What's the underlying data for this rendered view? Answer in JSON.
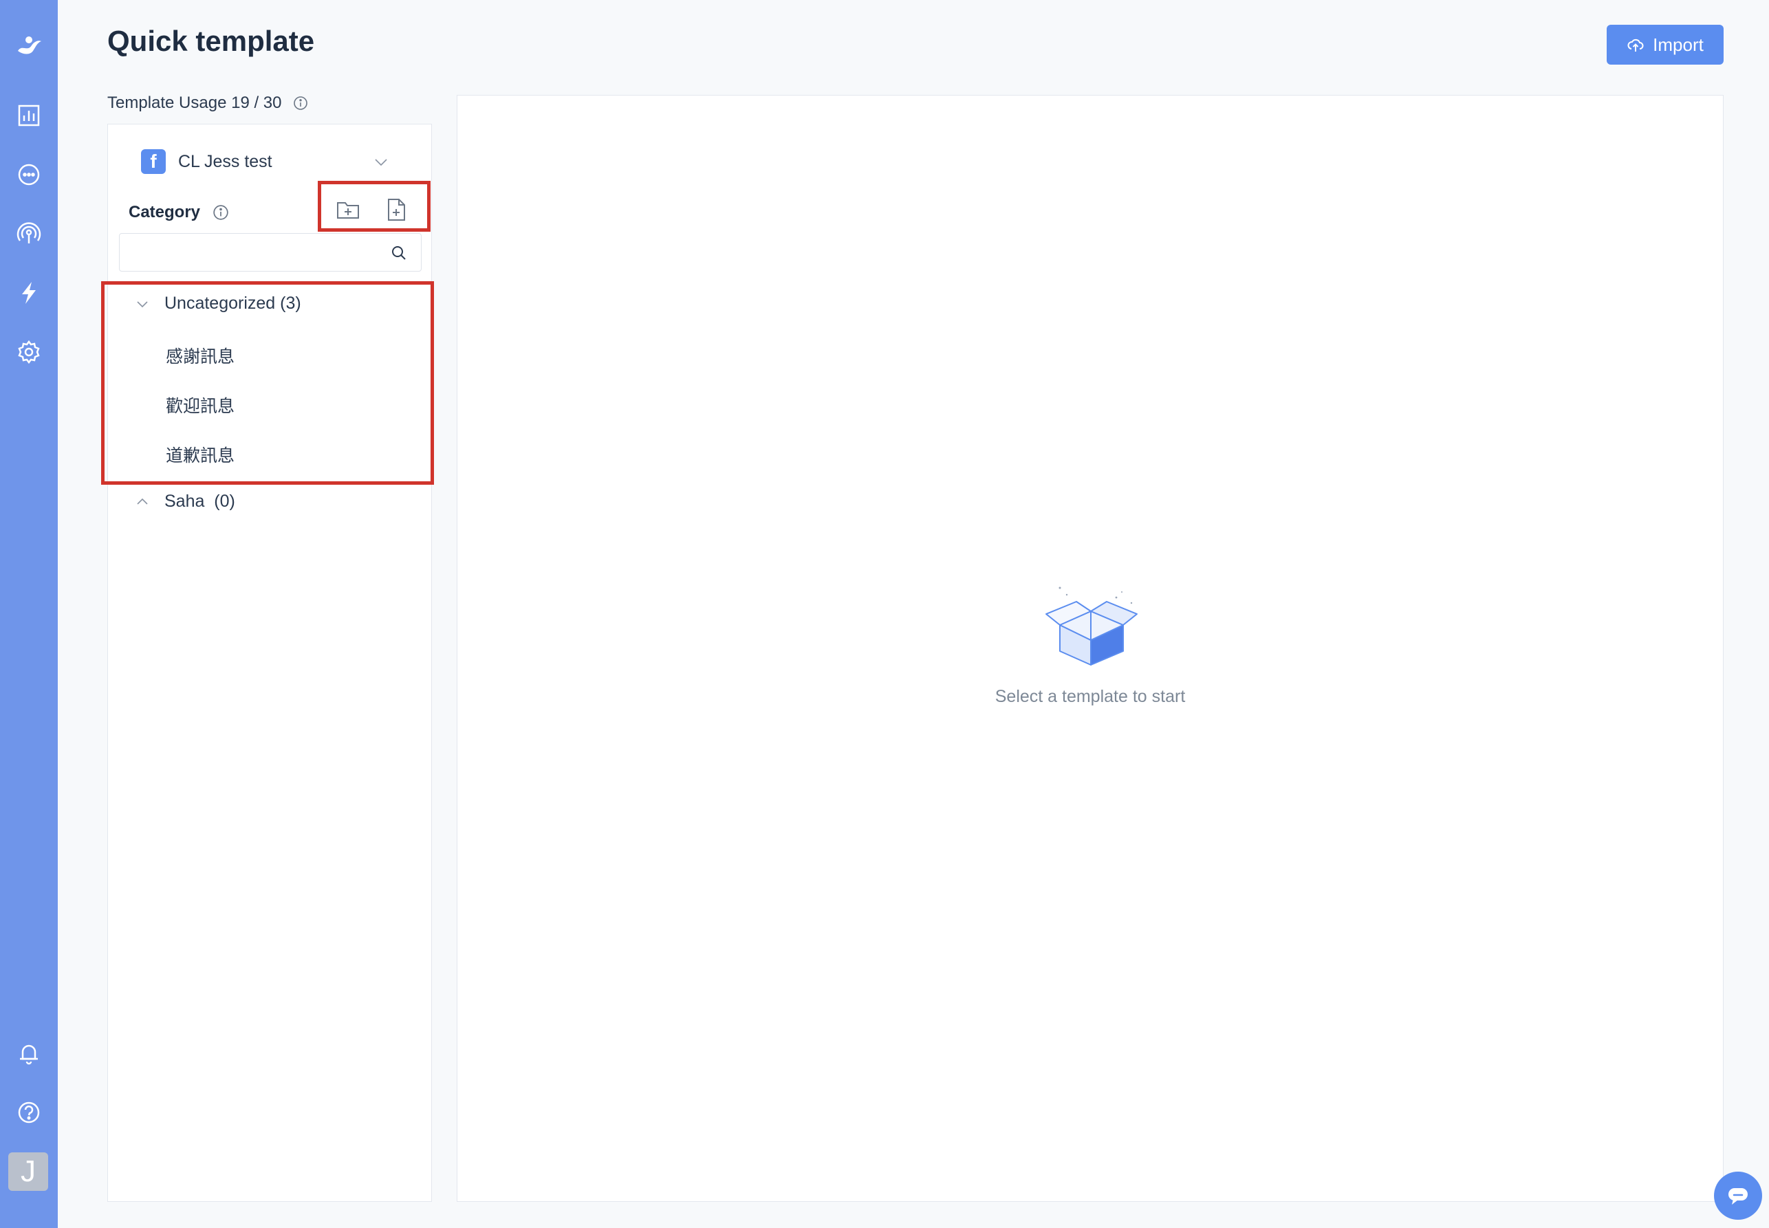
{
  "nav": {
    "icons": [
      "logo-icon",
      "analytics-icon",
      "chat-icon",
      "broadcast-icon",
      "lightning-icon",
      "settings-icon",
      "bell-icon",
      "help-icon"
    ],
    "avatar_letter": "J"
  },
  "header": {
    "title": "Quick template",
    "import_label": "Import"
  },
  "usage": {
    "text": "Template Usage 19 / 30"
  },
  "left_panel": {
    "page_name": "CL Jess test",
    "category_label": "Category",
    "search_placeholder": "",
    "groups": [
      {
        "label": "Uncategorized (3)",
        "expanded": true,
        "templates": [
          "感謝訊息",
          "歡迎訊息",
          "道歉訊息"
        ]
      },
      {
        "label": "Saha  (0)",
        "expanded": false,
        "templates": []
      }
    ]
  },
  "right_panel": {
    "empty_text": "Select a template to start"
  },
  "colors": {
    "nav_bg": "#6f95ea",
    "primary": "#5b8def",
    "highlight": "#d0342c"
  }
}
